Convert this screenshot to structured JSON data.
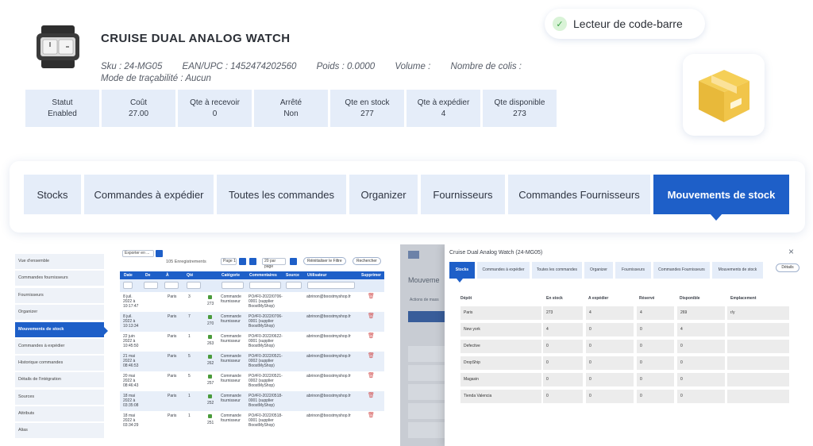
{
  "product": {
    "title": "CRUISE DUAL ANALOG WATCH",
    "sku": "Sku : 24-MG05",
    "ean": "EAN/UPC : 1452474202560",
    "weight": "Poids : 0.0000",
    "volume": "Volume :",
    "packages": "Nombre de colis :",
    "traceability": "Mode de traçabilité : Aucun"
  },
  "stats": [
    {
      "label": "Statut",
      "value": "Enabled"
    },
    {
      "label": "Coût",
      "value": "27.00"
    },
    {
      "label": "Qte à recevoir",
      "value": "0"
    },
    {
      "label": "Arrêté",
      "value": "Non"
    },
    {
      "label": "Qte en stock",
      "value": "277"
    },
    {
      "label": "Qte à expédier",
      "value": "4"
    },
    {
      "label": "Qte disponible",
      "value": "273"
    }
  ],
  "barcode": {
    "label": "Lecteur de code-barre",
    "icon": "check-icon"
  },
  "box_icon": "package-box-icon",
  "tabs": [
    "Stocks",
    "Commandes à expédier",
    "Toutes les commandes",
    "Organizer",
    "Fournisseurs",
    "Commandes Fournisseurs",
    "Mouvements de stock"
  ],
  "active_tab": "Mouvements de stock",
  "left_shot": {
    "sidebar": [
      "Vue d'ensemble",
      "Commandes fournisseurs",
      "Fournisseurs",
      "Organizer",
      "Mouvements de stock",
      "Commandes à expédier",
      "Historique commandes",
      "Détails de l'intégration",
      "Sources",
      "Attributs",
      "Alias"
    ],
    "active_sidebar": "Mouvements de stock",
    "export_label": "Exporter en ...",
    "records": "105 Enregistrements",
    "page": "Page 1",
    "per_page": "20 par page",
    "reset_filter": "Réinitialiser le Filtre",
    "search": "Rechercher",
    "columns": [
      "Date",
      "De",
      "À",
      "Qté",
      "Catégorie",
      "Commentaires",
      "Source",
      "Utilisateur",
      "Supprimer"
    ],
    "rows": [
      {
        "date": "8 juil. 2022 à 10:17:47",
        "to": "Paris",
        "qty": "3",
        "stock": "273",
        "cat": "Commande fournisseur",
        "comment": "PO#F0-2022/0706-0001 (supplier BoostMyShop)",
        "user": "abrinon@boostmyshop.fr"
      },
      {
        "date": "8 juil. 2022 à 10:13:34",
        "to": "Paris",
        "qty": "7",
        "stock": "270",
        "cat": "Commande fournisseur",
        "comment": "PO#F0-2022/0706-0001 (supplier BoostMyShop)",
        "user": "abrinon@boostmyshop.fr"
      },
      {
        "date": "22 juin 2022 à 10:45:50",
        "to": "Paris",
        "qty": "1",
        "stock": "263",
        "cat": "Commande fournisseur",
        "comment": "PO#F0-2022/0622-0001 (supplier BoostMyShop)",
        "user": "abrinon@boostmyshop.fr"
      },
      {
        "date": "21 mai 2022 à 08:46:53",
        "to": "Paris",
        "qty": "5",
        "stock": "262",
        "cat": "Commande fournisseur",
        "comment": "PO#F0-2022/0521-0002 (supplier BoostMyShop)",
        "user": "abrinon@boostmyshop.fr"
      },
      {
        "date": "20 mai 2022 à 08:46:43",
        "to": "Paris",
        "qty": "5",
        "stock": "257",
        "cat": "Commande fournisseur",
        "comment": "PO#F0-2022/0521-0002 (supplier BoostMyShop)",
        "user": "abrinon@boostmyshop.fr"
      },
      {
        "date": "18 mai 2022 à 03:35:08",
        "to": "Paris",
        "qty": "1",
        "stock": "252",
        "cat": "Commande fournisseur",
        "comment": "PO#F0-2022/0518-0001 (supplier BoostMyShop)",
        "user": "abrinon@boostmyshop.fr"
      },
      {
        "date": "18 mai 2022 à 03:34:29",
        "to": "Paris",
        "qty": "1",
        "stock": "251",
        "cat": "Commande fournisseur",
        "comment": "PO#F0-2022/0518-0001 (supplier BoostMyShop)",
        "user": "abrinon@boostmyshop.fr"
      }
    ]
  },
  "right_shot": {
    "bg_title": "Mouveme",
    "bg_actions": "Actions de mass",
    "title": "Cruise Dual Analog Watch (24-MG05)",
    "tabs": [
      "Stocks",
      "Commandes à expédier",
      "Toutes les commandes",
      "Organizer",
      "Fournisseurs",
      "Commandes Fournisseurs",
      "Mouvements de stock"
    ],
    "active_tab": "Stocks",
    "details": "Détails",
    "columns": [
      "Dépôt",
      "En stock",
      "A expédier",
      "Réservé",
      "Disponible",
      "Emplacement"
    ],
    "rows": [
      [
        "Paris",
        "273",
        "4",
        "4",
        "269",
        "r/y"
      ],
      [
        "New york",
        "4",
        "0",
        "0",
        "4",
        ""
      ],
      [
        "Defective",
        "0",
        "0",
        "0",
        "0",
        ""
      ],
      [
        "DropShip",
        "0",
        "0",
        "0",
        "0",
        ""
      ],
      [
        "Magasin",
        "0",
        "0",
        "0",
        "0",
        ""
      ],
      [
        "Tienda Valencia",
        "0",
        "0",
        "0",
        "0",
        ""
      ]
    ]
  }
}
